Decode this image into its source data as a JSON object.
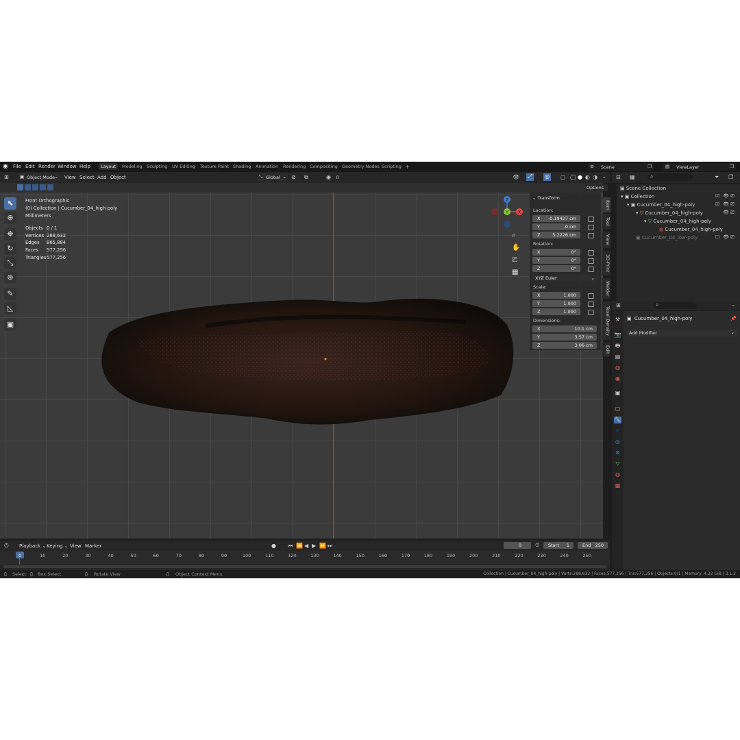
{
  "app_menu": [
    "File",
    "Edit",
    "Render",
    "Window",
    "Help"
  ],
  "workspaces": [
    "Layout",
    "Modeling",
    "Sculpting",
    "UV Editing",
    "Texture Paint",
    "Shading",
    "Animation",
    "Rendering",
    "Compositing",
    "Geometry Nodes",
    "Scripting",
    "+"
  ],
  "scene": "Scene",
  "view_layer": "ViewLayer",
  "header": {
    "mode": "Object Mode",
    "view": "View",
    "select": "Select",
    "add": "Add",
    "object": "Object",
    "orientation": "Global",
    "options": "Options"
  },
  "overlay": {
    "view_name": "Front Orthographic",
    "collection": "(0) Collection | Cucumber_04_high-poly",
    "units": "Millimeters",
    "stats": [
      {
        "label": "Objects",
        "value": "0 / 1"
      },
      {
        "label": "Vertices",
        "value": "288,632"
      },
      {
        "label": "Edges",
        "value": "865,884"
      },
      {
        "label": "Faces",
        "value": "577,256"
      },
      {
        "label": "Triangles",
        "value": "577,256"
      }
    ]
  },
  "gizmo": {
    "x": "X",
    "y": "Y",
    "z": "Z"
  },
  "transform": {
    "title": "Transform",
    "location_label": "Location:",
    "location": {
      "x": "-0.19427 cm",
      "y": "-0 cm",
      "z": "5.2226 cm"
    },
    "rotation_label": "Rotation:",
    "rotation": {
      "x": "0°",
      "y": "0°",
      "z": "0°"
    },
    "rotation_mode": "XYZ Euler",
    "scale_label": "Scale:",
    "scale": {
      "x": "1.000",
      "y": "1.000",
      "z": "1.000"
    },
    "dimensions_label": "Dimensions:",
    "dimensions": {
      "x": "10.1 cm",
      "y": "3.57 cm",
      "z": "3.06 cm"
    },
    "axis": {
      "x": "X",
      "y": "Y",
      "z": "Z"
    }
  },
  "side_tabs": [
    "Item",
    "Tool",
    "View",
    "3D-Print",
    "Welder",
    "Texel Density",
    "Edit"
  ],
  "outliner": {
    "rows": [
      "Scene Collection",
      "Collection",
      "Cucumber_04_high-poly",
      "Cucumber_04_high-poly",
      "Cucumber_04_high-poly",
      "Cucumber_04_high-poly",
      "Cucumber_04_low-poly"
    ]
  },
  "properties": {
    "object_name": "Cucumber_04_high-poly",
    "add_modifier": "Add Modifier"
  },
  "timeline": {
    "menus": [
      "Playback",
      "Keying",
      "View",
      "Marker"
    ],
    "current_frame": "0",
    "start_label": "Start",
    "start": "1",
    "end_label": "End",
    "end": "250",
    "frames": [
      "0",
      "10",
      "20",
      "30",
      "40",
      "50",
      "60",
      "70",
      "80",
      "90",
      "100",
      "110",
      "120",
      "130",
      "140",
      "150",
      "160",
      "170",
      "180",
      "190",
      "200",
      "210",
      "220",
      "230",
      "240",
      "250"
    ]
  },
  "status": {
    "select": "Select",
    "box_select": "Box Select",
    "rotate": "Rotate View",
    "context": "Object Context Menu",
    "info": "Collection | Cucumber_04_high-poly | Verts:288,632 | Faces:577,256 | Tris:577,256 | Objects:0/1 | Memory: 4.22 GiB | 3.1.2"
  },
  "colors": {
    "accent": "#4a6fa5",
    "gizmo_x": "#e54646",
    "gizmo_y": "#8ac53a",
    "gizmo_z": "#3f7fd6",
    "active_tab": "#2f2f2f"
  }
}
